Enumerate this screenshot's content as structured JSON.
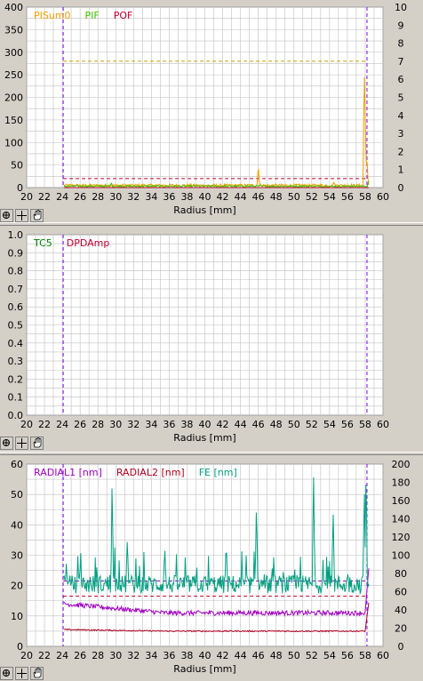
{
  "colors": {
    "grid": "#c0c0c0",
    "plot_bg": "#ffffff",
    "marker": "#8000ff"
  },
  "toolbar": {
    "tools": [
      "zoom-fit-icon",
      "crosshair-icon",
      "hand-pan-icon"
    ]
  },
  "chart_data": [
    {
      "type": "line",
      "title": "",
      "xlabel": "Radius [mm]",
      "xlim": [
        20,
        60
      ],
      "x_ticks": [
        20,
        22,
        24,
        26,
        28,
        30,
        32,
        34,
        36,
        38,
        40,
        42,
        44,
        46,
        48,
        50,
        52,
        54,
        56,
        58,
        60
      ],
      "ylim": [
        0,
        400
      ],
      "y_ticks": [
        0,
        50,
        100,
        150,
        200,
        250,
        300,
        350,
        400
      ],
      "y2lim": [
        0,
        10
      ],
      "y2_ticks": [
        0,
        1,
        2,
        3,
        4,
        5,
        6,
        7,
        8,
        9,
        10
      ],
      "markers_x": [
        24.1,
        58.2
      ],
      "thresholds": [
        {
          "value": 280,
          "color": "#c8a000"
        },
        {
          "value": 20,
          "color": "#c00030"
        }
      ],
      "grid": true,
      "series": [
        {
          "name": "PISum0",
          "color": "#f0a000",
          "baseline": 5,
          "noise": 3,
          "spikes": [
            [
              46.0,
              48
            ],
            [
              54.5,
              12
            ],
            [
              57.9,
              265
            ],
            [
              58.0,
              180
            ],
            [
              58.2,
              70
            ]
          ]
        },
        {
          "name": "PIF",
          "color": "#40c000",
          "baseline": 3,
          "noise": 2,
          "spikes": [
            [
              29.5,
              10
            ],
            [
              58.4,
              15
            ]
          ]
        },
        {
          "name": "POF",
          "color": "#c00030",
          "baseline": 0,
          "noise": 0,
          "spikes": []
        }
      ]
    },
    {
      "type": "line",
      "title": "",
      "xlabel": "Radius [mm]",
      "xlim": [
        20,
        60
      ],
      "x_ticks": [
        20,
        22,
        24,
        26,
        28,
        30,
        32,
        34,
        36,
        38,
        40,
        42,
        44,
        46,
        48,
        50,
        52,
        54,
        56,
        58,
        60
      ],
      "ylim": [
        0,
        1
      ],
      "y_ticks": [
        0.0,
        0.1,
        0.2,
        0.3,
        0.4,
        0.5,
        0.6,
        0.7,
        0.8,
        0.9,
        1.0
      ],
      "markers_x": [
        24.1,
        58.2
      ],
      "grid": true,
      "series": [
        {
          "name": "TC5",
          "color": "#008000"
        },
        {
          "name": "DPDAmp",
          "color": "#c00030"
        }
      ]
    },
    {
      "type": "line",
      "title": "",
      "xlabel": "Radius [mm]",
      "xlim": [
        20,
        60
      ],
      "x_ticks": [
        20,
        22,
        24,
        26,
        28,
        30,
        32,
        34,
        36,
        38,
        40,
        42,
        44,
        46,
        48,
        50,
        52,
        54,
        56,
        58,
        60
      ],
      "ylim": [
        0,
        60
      ],
      "y_ticks": [
        0,
        10,
        20,
        30,
        40,
        50,
        60
      ],
      "y2lim": [
        0,
        200
      ],
      "y2_ticks": [
        0,
        20,
        40,
        60,
        80,
        100,
        120,
        140,
        160,
        180,
        200
      ],
      "markers_x": [
        24.1,
        58.2
      ],
      "thresholds": [
        {
          "value": 21.5,
          "color": "#a000c0"
        },
        {
          "value": 16.5,
          "color": "#c00030"
        }
      ],
      "grid": true,
      "series": [
        {
          "name": "RADIAL1 [nm]",
          "color": "#a000c0",
          "start": 14,
          "end": 11,
          "noise": 0.8,
          "tail": 22
        },
        {
          "name": "RADIAL2 [nm]",
          "color": "#b00020",
          "start": 5.5,
          "end": 5,
          "noise": 0.2,
          "tail": 12
        },
        {
          "name": "FE [nm]",
          "color": "#00a080",
          "axis": "right",
          "baseline": 68,
          "noise": 10,
          "spikes": [
            [
              29.6,
              175
            ],
            [
              31.3,
              120
            ],
            [
              35.5,
              110
            ],
            [
              42.4,
              115
            ],
            [
              45.8,
              160
            ],
            [
              52.2,
              195
            ],
            [
              54.4,
              150
            ],
            [
              57.9,
              175
            ],
            [
              58.1,
              200
            ]
          ]
        }
      ]
    }
  ],
  "xlabel_text": "Radius [mm]"
}
